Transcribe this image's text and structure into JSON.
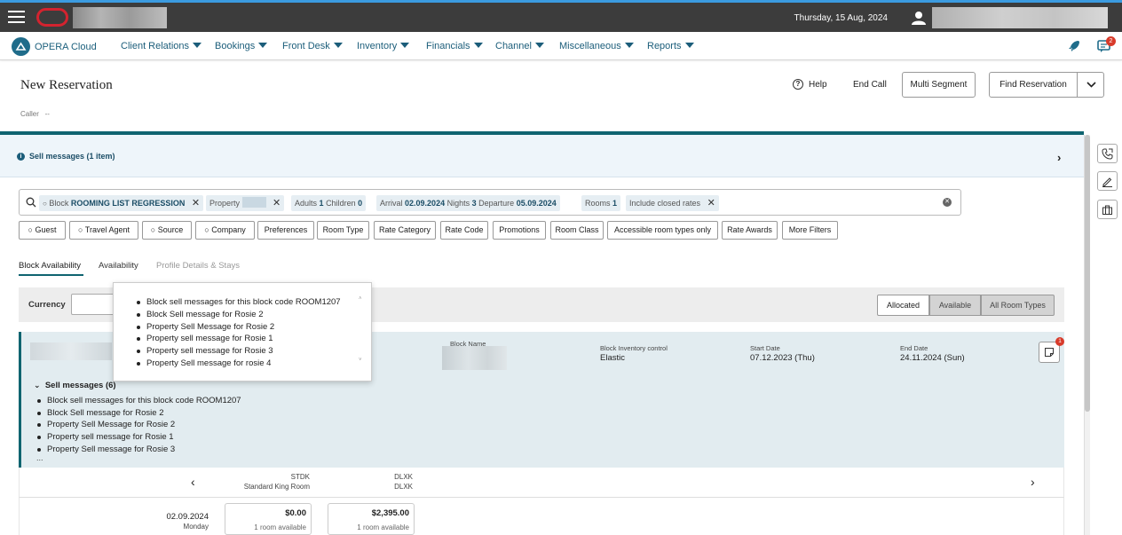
{
  "topbar": {
    "date": "Thursday, 15 Aug, 2024"
  },
  "nav": {
    "brand": "OPERA Cloud",
    "items": [
      "Client Relations",
      "Bookings",
      "Front Desk",
      "Inventory",
      "Financials",
      "Channel",
      "Miscellaneous",
      "Reports"
    ],
    "message_badge": "2"
  },
  "header": {
    "title": "New Reservation",
    "caller_label": "Caller",
    "caller_value": "--",
    "help": "Help",
    "end_call": "End Call",
    "multi_segment": "Multi Segment",
    "find_reservation": "Find Reservation"
  },
  "sell_banner": {
    "text": "Sell messages (1 item)"
  },
  "search": {
    "chips": [
      {
        "label": "Block",
        "value": "ROOMING LIST REGRESSION"
      },
      {
        "label": "Property",
        "value": ""
      },
      {
        "label": "Adults",
        "value": "1",
        "label2": "Children",
        "value2": "0"
      },
      {
        "label": "Arrival",
        "value": "02.09.2024",
        "label2": "Nights",
        "value2": "3",
        "label3": "Departure",
        "value3": "05.09.2024"
      },
      {
        "label": "Rooms",
        "value": "1"
      },
      {
        "label": "Include closed rates",
        "value": ""
      }
    ]
  },
  "filters": [
    "Guest",
    "Travel Agent",
    "Source",
    "Company",
    "Preferences",
    "Room Type",
    "Rate Category",
    "Rate Code",
    "Promotions",
    "Room Class",
    "Accessible room types only",
    "Rate Awards",
    "More Filters"
  ],
  "tabs": {
    "block_availability": "Block Availability",
    "availability": "Availability",
    "profile_details": "Profile Details & Stays"
  },
  "currency": {
    "label": "Currency",
    "value": ""
  },
  "segments": {
    "allocated": "Allocated",
    "available": "Available",
    "all_room_types": "All Room Types"
  },
  "popup": {
    "messages": [
      "Block sell messages for this block code ROOM1207",
      "Block Sell message for Rosie 2",
      "Property Sell Message for Rosie 2",
      "Property sell message for Rosie 1",
      "Property sell message for Rosie 3",
      "Property Sell message for rosie 4"
    ]
  },
  "block": {
    "block_name_label": "Block Name",
    "inventory_label": "Block Inventory control",
    "inventory_value": "Elastic",
    "start_label": "Start Date",
    "start_value": "07.12.2023 (Thu)",
    "end_label": "End Date",
    "end_value": "24.11.2024 (Sun)",
    "note_badge": "1",
    "sell_messages_header": "Sell messages (6)",
    "sell_messages": [
      "Block sell messages for this block code ROOM1207",
      "Block Sell message for Rosie 2",
      "Property Sell Message for Rosie 2",
      "Property sell message for Rosie 1",
      "Property Sell message for Rosie 3"
    ],
    "more": "..."
  },
  "room_types": [
    {
      "code": "STDK",
      "name": "Standard King Room"
    },
    {
      "code": "DLXK",
      "name": "DLXK"
    }
  ],
  "dates": [
    {
      "date": "02.09.2024",
      "day": "Monday",
      "rates": [
        {
          "amount": "$0.00",
          "available": "1 room available"
        },
        {
          "amount": "$2,395.00",
          "available": "1 room available"
        }
      ]
    }
  ],
  "colors": {
    "teal": "#0f6470",
    "nav_text": "#1b5d7a",
    "badge": "#d83b2b"
  }
}
